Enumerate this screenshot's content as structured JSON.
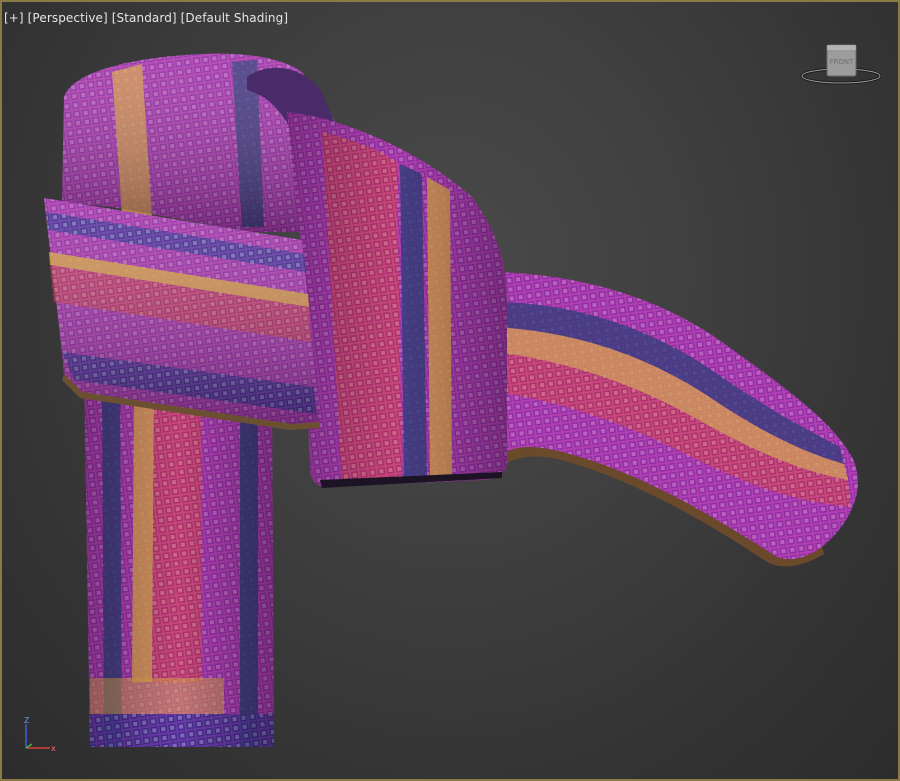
{
  "viewport": {
    "menu_plus": "[+]",
    "menu_perspective": "[Perspective]",
    "menu_standard": "[Standard]",
    "menu_shading": "[Default Shading]"
  },
  "viewcube": {
    "face_label": "FRONT"
  },
  "axis": {
    "z_label": "Z",
    "x_label": "x"
  },
  "colors": {
    "viewport_border": "#8a7a45",
    "checker_purple": "#a83fc2",
    "checker_pink": "#d24a8c",
    "checker_red": "#d24a3c",
    "stripe_orange": "#d8a24a",
    "stripe_navy": "#2f3f7a"
  }
}
